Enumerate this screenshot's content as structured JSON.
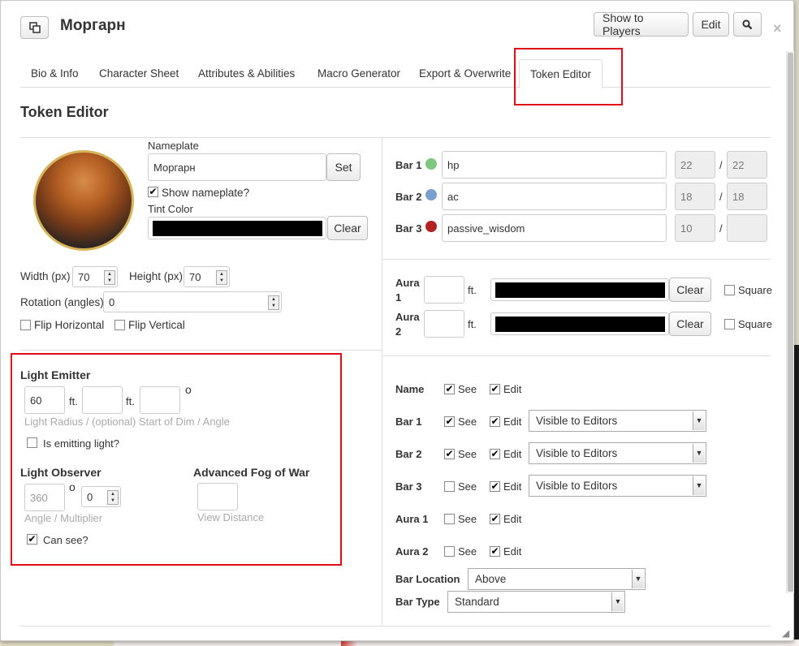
{
  "title": "Моргарн",
  "header_buttons": {
    "show_to_players": "Show to Players",
    "edit": "Edit"
  },
  "tabs": [
    "Bio & Info",
    "Character Sheet",
    "Attributes & Abilities",
    "Macro Generator",
    "Export & Overwrite",
    "Token Editor"
  ],
  "section_title": "Token Editor",
  "nameplate": {
    "label": "Nameplate",
    "value": "Моргарн",
    "set_label": "Set",
    "show_label": "Show nameplate?",
    "show_checked": true
  },
  "tint": {
    "label": "Tint Color",
    "clear_label": "Clear",
    "color": "#000000"
  },
  "size": {
    "width_label": "Width (px)",
    "width": "70",
    "height_label": "Height (px)",
    "height": "70"
  },
  "rotation": {
    "label": "Rotation (angles)",
    "value": "0"
  },
  "flip": {
    "horizontal": "Flip Horizontal",
    "vertical": "Flip Vertical"
  },
  "bars": [
    {
      "label": "Bar 1",
      "color": "#7cc87c",
      "attr": "hp",
      "current": "22",
      "max": "22"
    },
    {
      "label": "Bar 2",
      "color": "#7b9fcf",
      "attr": "ac",
      "current": "18",
      "max": "18"
    },
    {
      "label": "Bar 3",
      "color": "#b22222",
      "attr": "passive_wisdom",
      "current": "10",
      "max": ""
    }
  ],
  "slash": "/",
  "auras": [
    {
      "label_line1": "Aura",
      "label_line2": "1",
      "unit": "ft.",
      "clear_label": "Clear",
      "square_label": "Square"
    },
    {
      "label_line1": "Aura",
      "label_line2": "2",
      "unit": "ft.",
      "clear_label": "Clear",
      "square_label": "Square"
    }
  ],
  "light_emitter": {
    "title": "Light Emitter",
    "radius": "60",
    "unit": "ft.",
    "degree": "o",
    "hint": "Light Radius / (optional) Start of Dim / Angle",
    "emitting_label": "Is emitting light?"
  },
  "light_observer": {
    "title": "Light Observer",
    "angle": "360",
    "degree": "o",
    "multiplier": "0",
    "hint": "Angle / Multiplier",
    "can_see_label": "Can see?"
  },
  "fog": {
    "title": "Advanced Fog of War",
    "hint": "View Distance"
  },
  "permissions": {
    "see_label": "See",
    "edit_label": "Edit",
    "rows": [
      {
        "label": "Name",
        "see": true,
        "edit": true,
        "visibility": ""
      },
      {
        "label": "Bar 1",
        "see": true,
        "edit": true,
        "visibility": "Visible to Editors"
      },
      {
        "label": "Bar 2",
        "see": true,
        "edit": true,
        "visibility": "Visible to Editors"
      },
      {
        "label": "Bar 3",
        "see": false,
        "edit": true,
        "visibility": "Visible to Editors"
      },
      {
        "label": "Aura 1",
        "see": false,
        "edit": true,
        "visibility": ""
      },
      {
        "label": "Aura 2",
        "see": false,
        "edit": true,
        "visibility": ""
      }
    ]
  },
  "bar_location": {
    "label": "Bar Location",
    "value": "Above"
  },
  "bar_type": {
    "label": "Bar Type",
    "value": "Standard"
  },
  "check_glyph": "✔",
  "arrow_glyph": "▼",
  "spin_glyph_up": "▲",
  "spin_glyph_down": "▼",
  "close_glyph": "×",
  "resize_glyph": "◢"
}
